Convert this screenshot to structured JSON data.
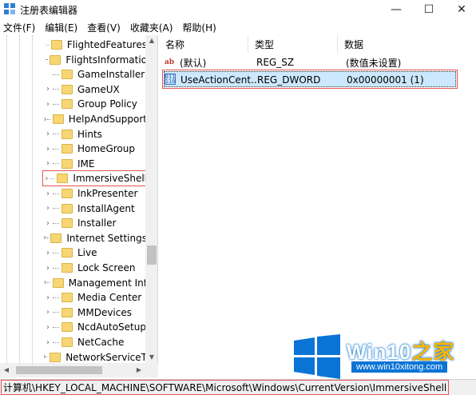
{
  "window": {
    "title": "注册表编辑器",
    "min_glyph": "—",
    "max_glyph": "☐",
    "close_glyph": "✕"
  },
  "menu": [
    "文件(F)",
    "编辑(E)",
    "查看(V)",
    "收藏夹(A)",
    "帮助(H)"
  ],
  "tree": {
    "items": [
      {
        "label": "FlightedFeatures",
        "expander": false
      },
      {
        "label": "FlightsInformatio",
        "expander": false
      },
      {
        "label": "GameInstaller",
        "expander": false
      },
      {
        "label": "GameUX",
        "expander": true
      },
      {
        "label": "Group Policy",
        "expander": true
      },
      {
        "label": "HelpAndSupport",
        "expander": true
      },
      {
        "label": "Hints",
        "expander": true
      },
      {
        "label": "HomeGroup",
        "expander": true
      },
      {
        "label": "IME",
        "expander": true
      },
      {
        "label": "ImmersiveShell",
        "expander": true,
        "selected": true
      },
      {
        "label": "InkPresenter",
        "expander": true
      },
      {
        "label": "InstallAgent",
        "expander": true
      },
      {
        "label": "Installer",
        "expander": true
      },
      {
        "label": "Internet Settings",
        "expander": true
      },
      {
        "label": "Live",
        "expander": true
      },
      {
        "label": "Lock Screen",
        "expander": true
      },
      {
        "label": "Management Inf",
        "expander": true
      },
      {
        "label": "Media Center",
        "expander": true
      },
      {
        "label": "MMDevices",
        "expander": true
      },
      {
        "label": "NcdAutoSetup",
        "expander": true
      },
      {
        "label": "NetCache",
        "expander": true
      },
      {
        "label": "NetworkServiceT",
        "expander": true
      }
    ]
  },
  "list": {
    "headers": {
      "name": "名称",
      "type": "类型",
      "data": "数据"
    },
    "rows": [
      {
        "icon": "string-value-icon",
        "name": "(默认)",
        "type": "REG_SZ",
        "data": "(数值未设置)",
        "selected": false
      },
      {
        "icon": "dword-value-icon",
        "name": "UseActionCent...",
        "type": "REG_DWORD",
        "data": "0x00000001 (1)",
        "selected": true
      }
    ]
  },
  "status": {
    "path": "计算机\\HKEY_LOCAL_MACHINE\\SOFTWARE\\Microsoft\\Windows\\CurrentVersion\\ImmersiveShell"
  },
  "watermark": {
    "brand": "Win10",
    "brand_suffix": "之家",
    "url": "www.win10xitong.com"
  },
  "colors": {
    "highlight_box": "#e05555",
    "selection": "#cce8ff",
    "folder": "#f7d673",
    "logo_blue": "#0a74d6"
  }
}
